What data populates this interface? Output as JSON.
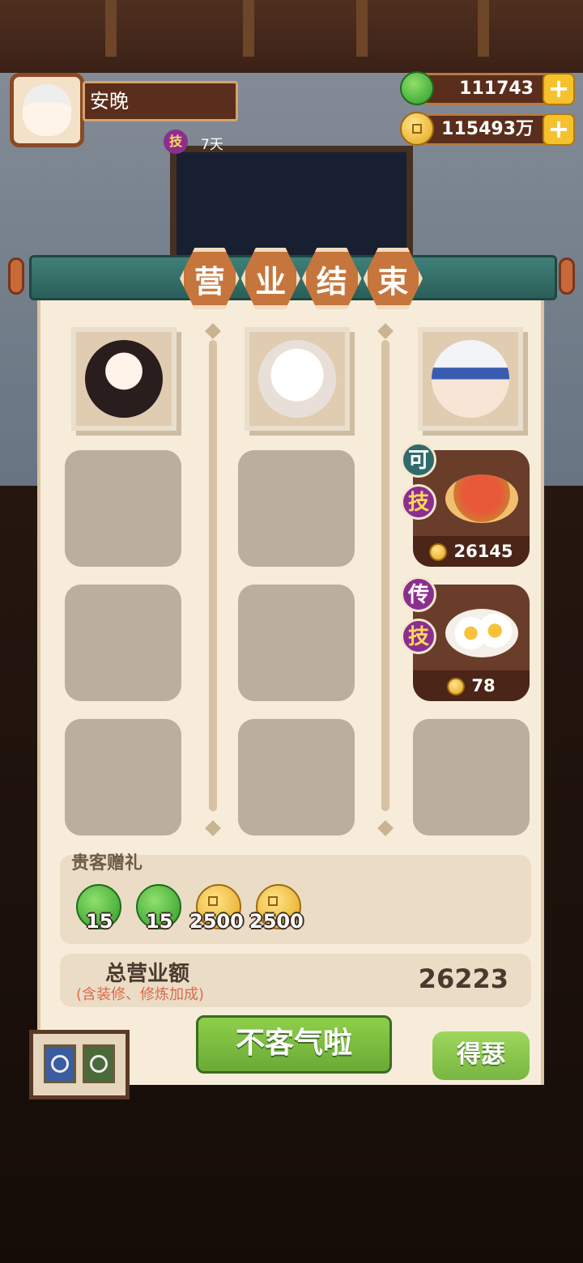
{
  "player": {
    "name": "安晚",
    "skill_badge": "技",
    "skill_days": "7天"
  },
  "resources": {
    "jade": "111743",
    "coins": "115493万",
    "plus": "+"
  },
  "panel": {
    "title_chars": [
      "营",
      "业",
      "结",
      "束"
    ],
    "columns": [
      {
        "guest": "skunk-girl"
      },
      {
        "guest": "white-cat"
      },
      {
        "guest": "masked-boy"
      }
    ],
    "dishes": [
      {
        "rarity_badge": "可",
        "skill_badge": "技",
        "price": "26145"
      },
      {
        "rarity_badge": "传",
        "skill_badge": "技",
        "price": "78"
      }
    ]
  },
  "gifts": {
    "title": "贵客赠礼",
    "items": [
      {
        "type": "jade",
        "qty": "15"
      },
      {
        "type": "jade",
        "qty": "15"
      },
      {
        "type": "coin",
        "qty": "2500"
      },
      {
        "type": "coin",
        "qty": "2500"
      }
    ]
  },
  "total": {
    "label": "总营业额",
    "sublabel": "(含装修、修炼加成)",
    "value": "26223"
  },
  "buttons": {
    "confirm": "不客气啦",
    "side": "得瑟"
  },
  "colors": {
    "panel_bg": "#f7ecd9",
    "confirm_green": "#7cbd40",
    "title_orange": "#c6763c",
    "rod_teal": "#3f8078"
  }
}
